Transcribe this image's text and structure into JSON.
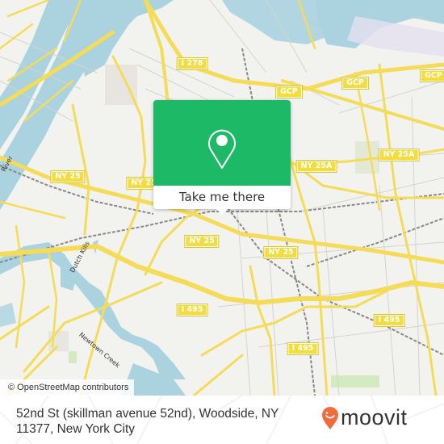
{
  "map": {
    "attribution": "© OpenStreetMap contributors",
    "highway_shields": [
      {
        "label": "I 278",
        "name": "i278"
      },
      {
        "label": "GCP",
        "name": "gcp-1"
      },
      {
        "label": "GCP",
        "name": "gcp-2"
      },
      {
        "label": "GCP",
        "name": "gcp-3"
      },
      {
        "label": "NY 25",
        "name": "ny25-1"
      },
      {
        "label": "NY 25",
        "name": "ny25-2"
      },
      {
        "label": "NY 25",
        "name": "ny25-3"
      },
      {
        "label": "NY 25",
        "name": "ny25-4"
      },
      {
        "label": "NY 25A",
        "name": "ny25a-1"
      },
      {
        "label": "NY 25A",
        "name": "ny25a-2"
      },
      {
        "label": "I 495",
        "name": "i495-1"
      },
      {
        "label": "I 495",
        "name": "i495-2"
      },
      {
        "label": "I 495",
        "name": "i495-3"
      }
    ],
    "water_labels": {
      "newtown_creek": "Newtown Creek",
      "dutch_kills": "Dutch Kills",
      "river": "River"
    },
    "colors": {
      "land": "#f2f2ef",
      "water": "#aad3df",
      "road": "#f4dc58",
      "park": "#d4eac0"
    }
  },
  "popup": {
    "button_label": "Take me there",
    "icon": "map-pin-icon",
    "accent": "#1db967"
  },
  "footer": {
    "address": "52nd St (skillman avenue 52nd), Woodside, NY 11377, New York City",
    "brand": "moovit",
    "brand_icon": "moovit-pin-smile-icon",
    "brand_color": "#f26b3a"
  }
}
